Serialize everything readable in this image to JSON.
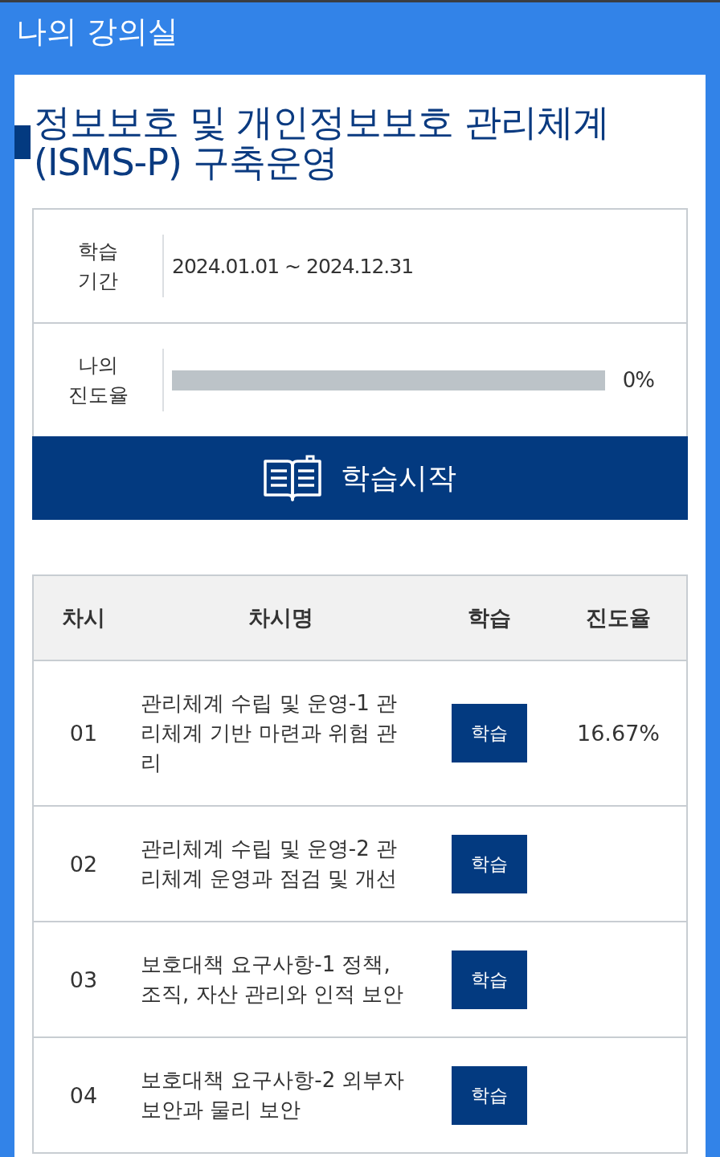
{
  "header": {
    "title": "나의 강의실"
  },
  "course": {
    "title": "정보보호 및 개인정보보호 관리체계 (ISMS-P) 구축운영"
  },
  "info": {
    "period_label": "학습 기간",
    "period": "2024.01.01 ~ 2024.12.31",
    "progress_label": "나의 진도율",
    "progress": {
      "level": 0,
      "reading": "0%"
    }
  },
  "start_button": {
    "label": "학습시작"
  },
  "lessons": {
    "columns": [
      "차시",
      "차시명",
      "학습",
      "진도율"
    ],
    "rows": [
      {
        "number": "01",
        "title": "관리체계 수립 및 운영-1 관리체계 기반 마련과 위험 관리",
        "button": "학습",
        "rate": "16.67%"
      },
      {
        "number": "02",
        "title": "관리체계 수립 및 운영-2 관리체계 운영과 점검 및 개선",
        "button": "학습"
      },
      {
        "number": "03",
        "title": "보호대책 요구사항-1 정책, 조직, 자산 관리와 인적 보안",
        "button": "학습"
      },
      {
        "number": "04",
        "title": "보호대책 요구사항-2 외부자 보안과 물리 보안",
        "button": "학습"
      }
    ]
  }
}
